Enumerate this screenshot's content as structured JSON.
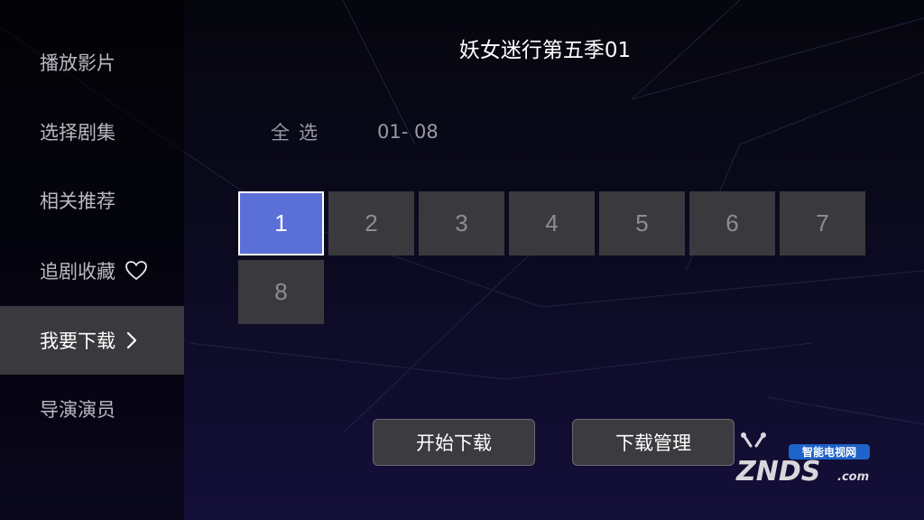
{
  "title": "妖女迷行第五季01",
  "sidebar": {
    "items": [
      {
        "label": "播放影片"
      },
      {
        "label": "选择剧集"
      },
      {
        "label": "相关推荐"
      },
      {
        "label": "追剧收藏",
        "icon": "heart-outline-icon"
      },
      {
        "label": "我要下载",
        "icon": "chevron-right-icon",
        "active": true
      },
      {
        "label": "导演演员"
      }
    ]
  },
  "download": {
    "select_all_label": "全选",
    "range_tab_label": "01- 08",
    "episodes": [
      "1",
      "2",
      "3",
      "4",
      "5",
      "6",
      "7",
      "8"
    ],
    "selected_episode": "1"
  },
  "buttons": {
    "start_download": "开始下载",
    "download_manage": "下载管理"
  },
  "logo": {
    "tagline": "智能电视网",
    "brand": "ZNDS",
    "suffix": ".com"
  },
  "colors": {
    "selected_episode": "#5b6fd8",
    "tile": "#3a3a3e",
    "active_sidebar": "#3a3a3e",
    "logo_badge": "#1e63c9"
  }
}
